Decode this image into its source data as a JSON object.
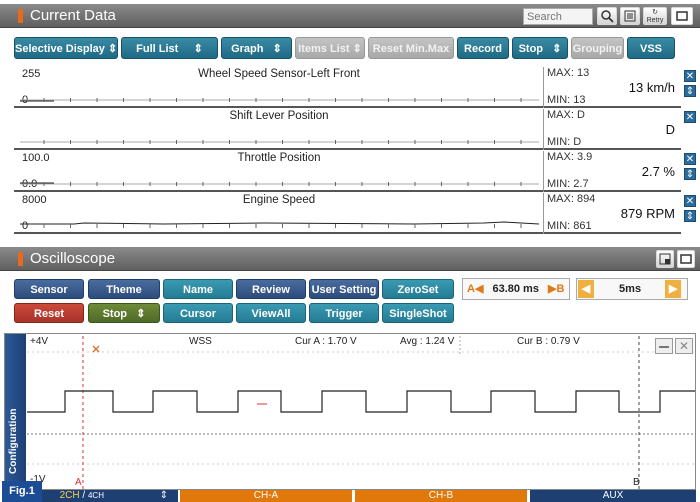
{
  "current_data": {
    "title": "Current Data",
    "search_placeholder": "Search",
    "retry_label": "Retry",
    "toolbar": {
      "selective_display": "Selective Display",
      "full_list": "Full List",
      "graph": "Graph",
      "items_list": "Items List",
      "reset_minmax": "Reset Min.Max",
      "record": "Record",
      "stop": "Stop",
      "grouping": "Grouping",
      "vss": "VSS"
    },
    "rows": [
      {
        "name": "Wheel Speed Sensor-Left Front",
        "scale_max": "255",
        "scale_min": "0",
        "max": "MAX: 13",
        "min": "MIN: 13",
        "value": "13 km/h"
      },
      {
        "name": "Shift Lever Position",
        "scale_max": "",
        "scale_min": "",
        "max": "MAX: D",
        "min": "MIN: D",
        "value": "D"
      },
      {
        "name": "Throttle Position",
        "scale_max": "100.0",
        "scale_min": "0.0",
        "max": "MAX: 3.9",
        "min": "MIN: 2.7",
        "value": "2.7 %"
      },
      {
        "name": "Engine Speed",
        "scale_max": "8000",
        "scale_min": "0",
        "max": "MAX: 894",
        "min": "MIN: 861",
        "value": "879 RPM"
      }
    ]
  },
  "oscilloscope": {
    "title": "Oscilloscope",
    "buttons_row1": {
      "sensor": "Sensor",
      "theme": "Theme",
      "name": "Name",
      "review": "Review",
      "user_setting": "User Setting",
      "zeroset": "ZeroSet"
    },
    "buttons_row2": {
      "reset": "Reset",
      "stop": "Stop",
      "cursor": "Cursor",
      "viewall": "ViewAll",
      "trigger": "Trigger",
      "singleshot": "SingleShot"
    },
    "ab_label_a": "A",
    "ab_label_b": "B",
    "ab_time": "63.80 ms",
    "timebase": "5ms",
    "config_label": "Configuration",
    "y_top": "+4V",
    "y_bottom": "-1V",
    "channel_label": "WSS",
    "cur_a": "Cur A : 1.70 V",
    "avg": "Avg : 1.24 V",
    "cur_b": "Cur B : 0.79 V",
    "cursor_a": "A",
    "cursor_b": "B"
  },
  "channels": {
    "ch_count_main": "2CH",
    "ch_count_sub": "4CH",
    "ch_a": "CH-A",
    "ch_b": "CH-B",
    "aux": "AUX"
  },
  "figure_label": "Fig.1",
  "colors": {
    "teal_button": "#2a7a96",
    "orange_tab": "#e0780c",
    "navy_tab": "#1d3f72",
    "accent_orange": "#e86a1e"
  }
}
